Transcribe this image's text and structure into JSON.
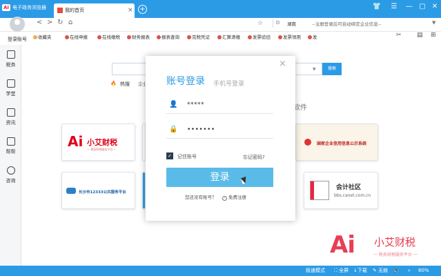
{
  "window": {
    "app_logo": "Ai",
    "app_title": "电子政务浏览器",
    "tab_label": "我的首页",
    "tab_close": "×",
    "new_tab": "+",
    "controls": [
      "shirt-icon",
      "menu-icon",
      "minimize-icon",
      "maximize-icon",
      "close-icon"
    ]
  },
  "nav": {
    "login_link": "登录账号",
    "location": "湖南",
    "notice": "--注册登录后可自动绑定企业信息--",
    "buttons": [
      "<",
      ">",
      "↻",
      "⌂"
    ]
  },
  "bookmarks": [
    "收藏夹",
    "在线申报",
    "在线缴税",
    "财务报表",
    "报表查询",
    "完税凭证",
    "汇算清缴",
    "发票验旧",
    "发票领用",
    "发"
  ],
  "sidebar": [
    {
      "label": "税务",
      "icon": "tax-icon"
    },
    {
      "label": "学堂",
      "icon": "school-icon"
    },
    {
      "label": "资讯",
      "icon": "news-icon"
    },
    {
      "label": "帮帮",
      "icon": "help-icon"
    },
    {
      "label": "咨询",
      "icon": "consult-icon"
    }
  ],
  "search": {
    "button": "搜索",
    "hot_label": "热搜",
    "hot_extra": "企业"
  },
  "section": {
    "title": "软件"
  },
  "cards": {
    "xiaoai": "小艾财税",
    "xiaoai_sub": "一 税务财税服务平台 一",
    "gsxt": "国家企业信用信息公示系统",
    "cs12333": "长沙市12333公共服务平台",
    "kjsq": "会计社区",
    "kjsq_url": "bbs.canet.com.cn"
  },
  "modal": {
    "close": "×",
    "tab_account": "账号登录",
    "tab_phone": "手机号登录",
    "username_value": "*****",
    "password_value": "•••••••",
    "remember": "记住账号",
    "forgot": "忘记密码?",
    "login_button": "登录",
    "no_account": "您还没有账号？",
    "register": "免费注册"
  },
  "watermark": {
    "logo": "Ai",
    "text": "小艾财税",
    "sub": "一 税务财税服务平台 一"
  },
  "status": {
    "mode": "极速模式",
    "fullscreen": "全屏",
    "download": "下载",
    "nograph": "无痕",
    "zoom": "80%"
  },
  "colors": {
    "primary": "#2c9be6",
    "login_button": "#5bbbe8",
    "accent_red": "#e0001b"
  }
}
